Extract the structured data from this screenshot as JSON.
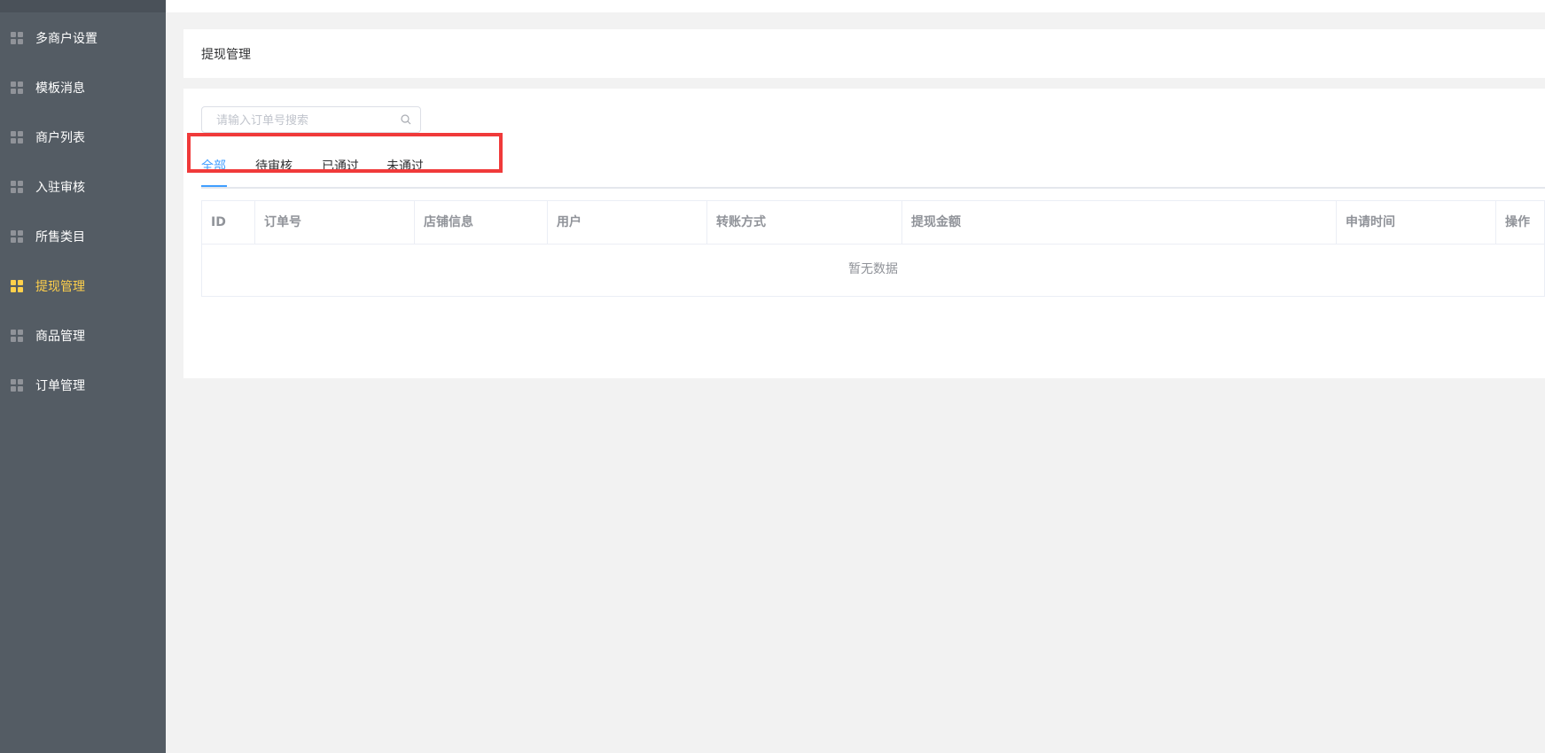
{
  "sidebar": {
    "items": [
      {
        "label": "多商户设置",
        "active": false
      },
      {
        "label": "模板消息",
        "active": false
      },
      {
        "label": "商户列表",
        "active": false
      },
      {
        "label": "入驻审核",
        "active": false
      },
      {
        "label": "所售类目",
        "active": false
      },
      {
        "label": "提现管理",
        "active": true
      },
      {
        "label": "商品管理",
        "active": false
      },
      {
        "label": "订单管理",
        "active": false
      }
    ],
    "icon": "grid-icon",
    "active_color": "#ffd04b"
  },
  "page": {
    "title": "提现管理"
  },
  "search": {
    "placeholder": "请输入订单号搜索",
    "value": ""
  },
  "tabs": [
    {
      "label": "全部",
      "active": true
    },
    {
      "label": "待审核",
      "active": false
    },
    {
      "label": "已通过",
      "active": false
    },
    {
      "label": "未通过",
      "active": false
    }
  ],
  "table": {
    "columns": [
      "ID",
      "订单号",
      "店铺信息",
      "用户",
      "转账方式",
      "提现金额",
      "申请时间",
      "操作"
    ],
    "rows": [],
    "empty_text": "暂无数据"
  },
  "colors": {
    "sidebar_bg": "#545c64",
    "accent": "#409eff",
    "highlight": "#f03a3a"
  }
}
